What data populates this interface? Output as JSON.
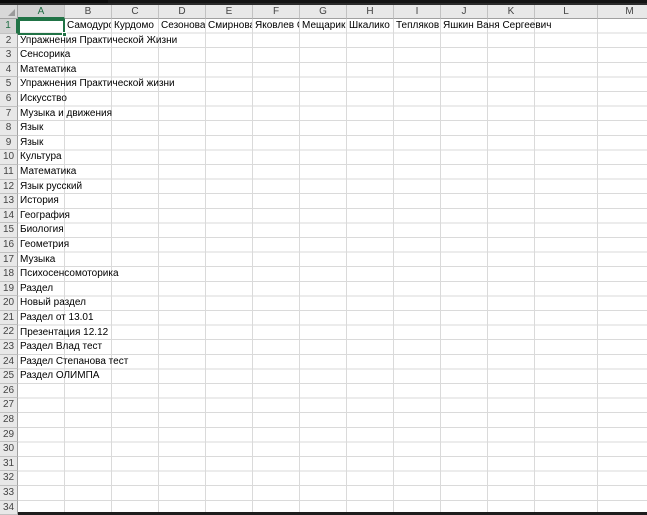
{
  "sheet": {
    "columns": [
      "A",
      "B",
      "C",
      "D",
      "E",
      "F",
      "G",
      "H",
      "I",
      "J",
      "K",
      "L",
      "M"
    ],
    "selected_column": "A",
    "selected_row": 1,
    "row_numbers": [
      1,
      2,
      3,
      4,
      5,
      6,
      7,
      8,
      9,
      10,
      11,
      12,
      13,
      14,
      15,
      16,
      17,
      18,
      19,
      20,
      21,
      22,
      23,
      24,
      25,
      26,
      27,
      28,
      29,
      30,
      31,
      32,
      33,
      34
    ],
    "header_row": {
      "B": "Самодуро",
      "C": "Курдомо",
      "D": "Сезонова",
      "E": "Смирнова",
      "F": "Яковлев С",
      "G": "Мещарик",
      "H": "Шкалико",
      "I": "Тепляков",
      "J": "Яшкин Ваня Сергеевич"
    },
    "column_a": [
      "",
      "Упражнения Практической Жизни",
      "Сенсорика",
      "Математика",
      "Упражнения Практической жизни",
      "Искусство",
      "Музыка и движения",
      "Язык",
      "Язык",
      "Культура",
      "Математика",
      "Язык русский",
      "История",
      "География",
      "Биология",
      "Геометрия",
      "Музыка",
      "Психосенсомоторика",
      "Раздел",
      "Новый раздел",
      "Раздел от 13.01",
      "Презентация 12.12",
      "Раздел Влад тест",
      "Раздел Степанова тест",
      "Раздел ОЛИМПА"
    ]
  }
}
